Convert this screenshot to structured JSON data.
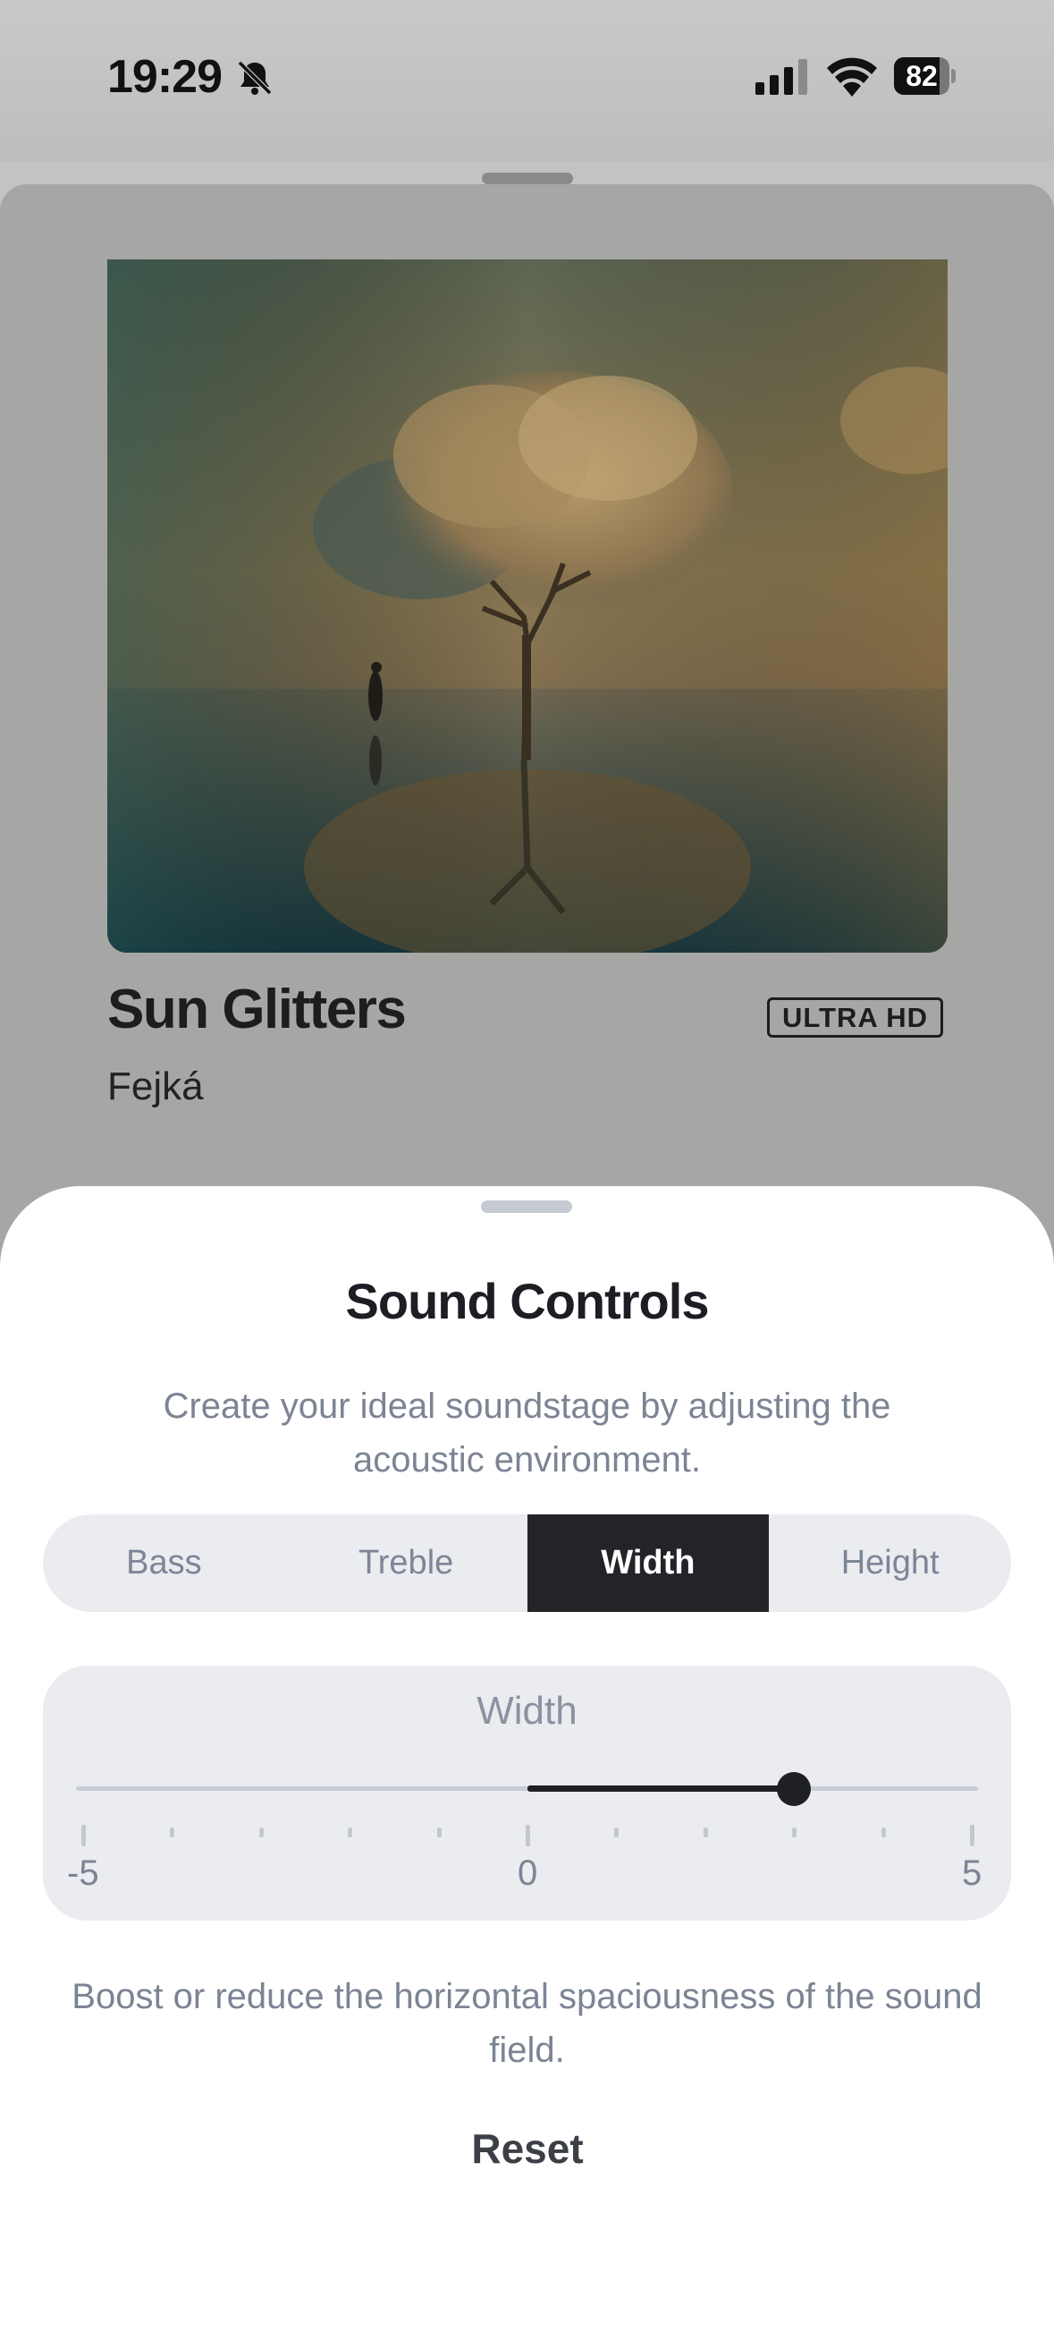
{
  "status_bar": {
    "time": "19:29",
    "battery": "82",
    "battery_level": 0.82,
    "icons": [
      "bell-slash-icon",
      "cellular-signal-icon",
      "wifi-icon",
      "battery-icon"
    ]
  },
  "now_playing": {
    "title": "Sun Glitters",
    "artist": "Fejká",
    "quality_badge": "ULTRA HD",
    "album_art": "tree-with-cloud-canopy-reflected-in-water"
  },
  "sound_controls": {
    "title": "Sound Controls",
    "description": "Create your ideal soundstage by adjusting the acoustic environment.",
    "tabs": [
      {
        "label": "Bass",
        "active": false
      },
      {
        "label": "Treble",
        "active": false
      },
      {
        "label": "Width",
        "active": true
      },
      {
        "label": "Height",
        "active": false
      }
    ],
    "slider": {
      "label": "Width",
      "min": -5,
      "max": 5,
      "value": 3,
      "min_label": "-5",
      "mid_label": "0",
      "max_label": "5"
    },
    "help_text": "Boost or reduce the horizontal spaciousness of the sound field.",
    "reset_label": "Reset"
  },
  "colors": {
    "accent": "#1f2024",
    "muted_text": "#7c8494",
    "segment_bg": "#ebecf0"
  }
}
